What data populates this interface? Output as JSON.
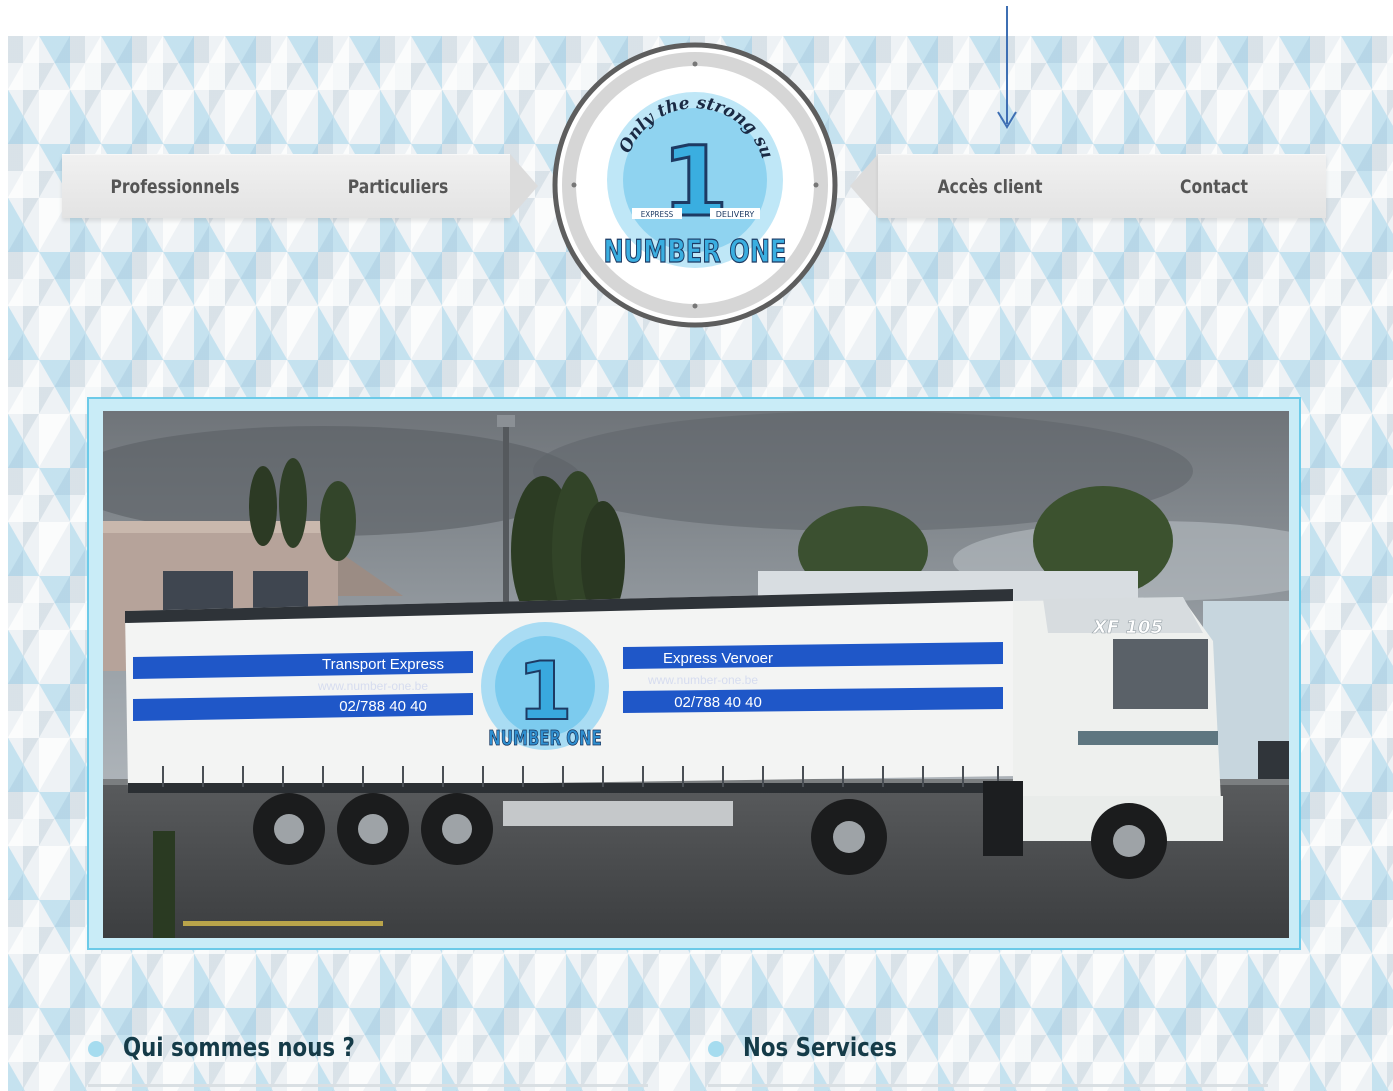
{
  "nav": {
    "left": [
      {
        "label": "Professionnels"
      },
      {
        "label": "Particuliers"
      }
    ],
    "right": [
      {
        "label": "Accès client"
      },
      {
        "label": "Contact"
      }
    ]
  },
  "logo": {
    "tagline": "Only the strong survive !",
    "numeral": "1",
    "left_tag": "EXPRESS",
    "right_tag": "DELIVERY",
    "name": "NUMBER ONE"
  },
  "hero": {
    "trailer_left_title": "Transport Express",
    "trailer_left_url": "www.number-one.be",
    "trailer_left_phone": "02/788 40 40",
    "trailer_right_title": "Express Vervoer",
    "trailer_right_url": "www.number-one.be",
    "trailer_right_phone": "02/788 40 40",
    "cab_badge": "XF 105",
    "logo_name": "NUMBER ONE"
  },
  "sections": [
    {
      "title": "Qui sommes nous ?"
    },
    {
      "title": "Nos Services"
    }
  ],
  "colors": {
    "accent": "#6ccae8",
    "stripe_blue": "#1f57c8",
    "heading": "#153b48",
    "nav_text": "#555555",
    "arrow": "#3e6fb3"
  }
}
